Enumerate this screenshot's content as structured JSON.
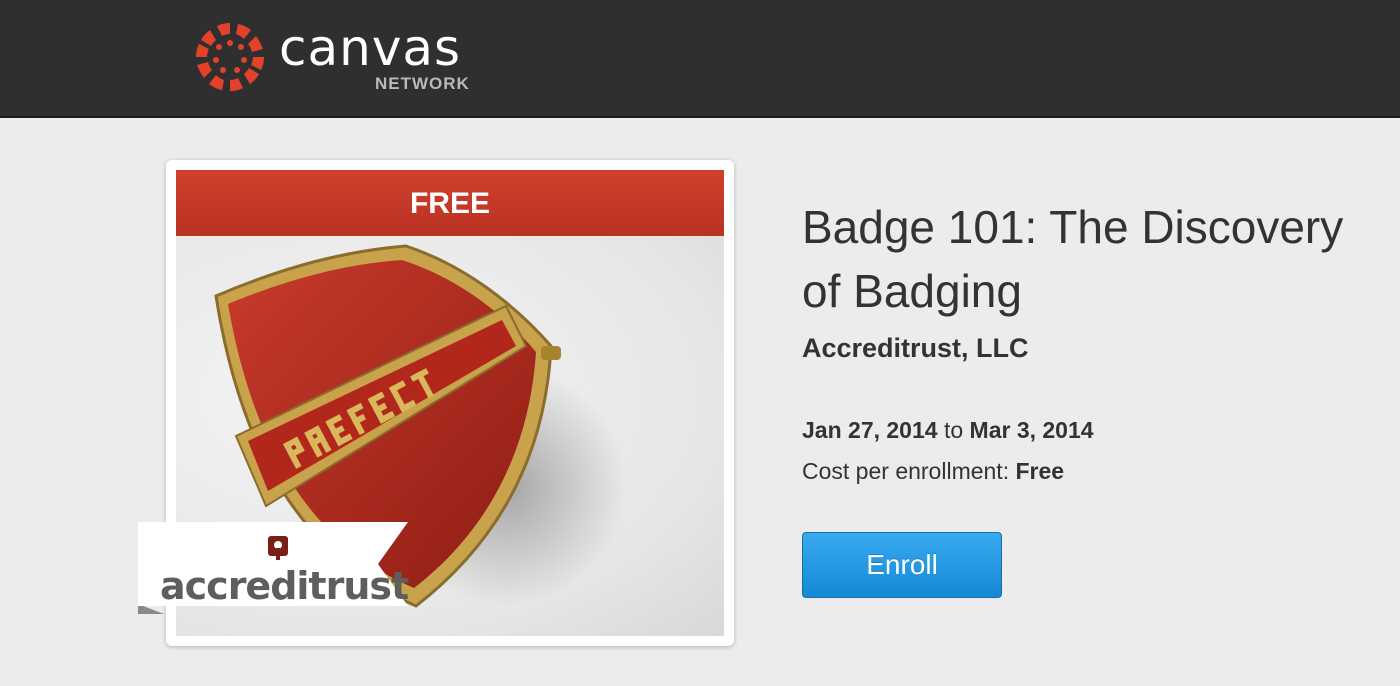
{
  "header": {
    "logo_word": "canvas",
    "logo_sub": "NETWORK",
    "logo_color": "#e2412a"
  },
  "course": {
    "price_badge": "FREE",
    "image_icon": "prefect-badge-image",
    "provider_logo_text": "accreditrust",
    "title": "Badge 101: The Discovery of Badging",
    "provider": "Accreditrust, LLC",
    "start_date": "Jan 27, 2014",
    "date_separator": "to",
    "end_date": "Mar 3, 2014",
    "cost_label": "Cost per enrollment:",
    "cost_value": "Free",
    "enroll_label": "Enroll",
    "enroll_color": "#2398e4"
  }
}
